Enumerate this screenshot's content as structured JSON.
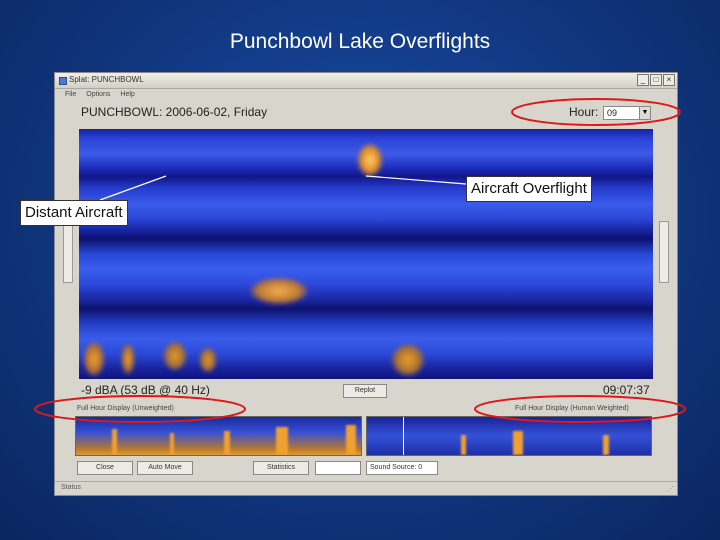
{
  "slide": {
    "title": "Punchbowl Lake Overflights"
  },
  "window": {
    "title": "Splat: PUNCHBOWL",
    "controls": [
      "_",
      "□",
      "×"
    ],
    "menu": [
      "File",
      "Options",
      "Help"
    ]
  },
  "header": {
    "location": "PUNCHBOWL: 2006-06-02, Friday",
    "hour_label": "Hour:",
    "hour_value": "09"
  },
  "readout": {
    "level": "-9 dBA (53 dB @ 40 Hz)",
    "replot_button": "Replot",
    "time": "09:07:37"
  },
  "panels": {
    "left_label": "Full Hour Display (Unweighted)",
    "right_label": "Full Hour Display (Human Weighted)"
  },
  "buttons": {
    "close": "Close",
    "auto_move": "Auto Move",
    "statistics": "Statistics",
    "sound_source": "Sound Source: 0"
  },
  "statusbar": {
    "text": "Status"
  },
  "annotations": {
    "aircraft_overflight": "Aircraft Overflight",
    "distant_aircraft": "Distant Aircraft"
  },
  "colors": {
    "background": "#123a86",
    "annotation_ellipse": "#e01818",
    "spectrogram_hot": "#f0a030"
  }
}
